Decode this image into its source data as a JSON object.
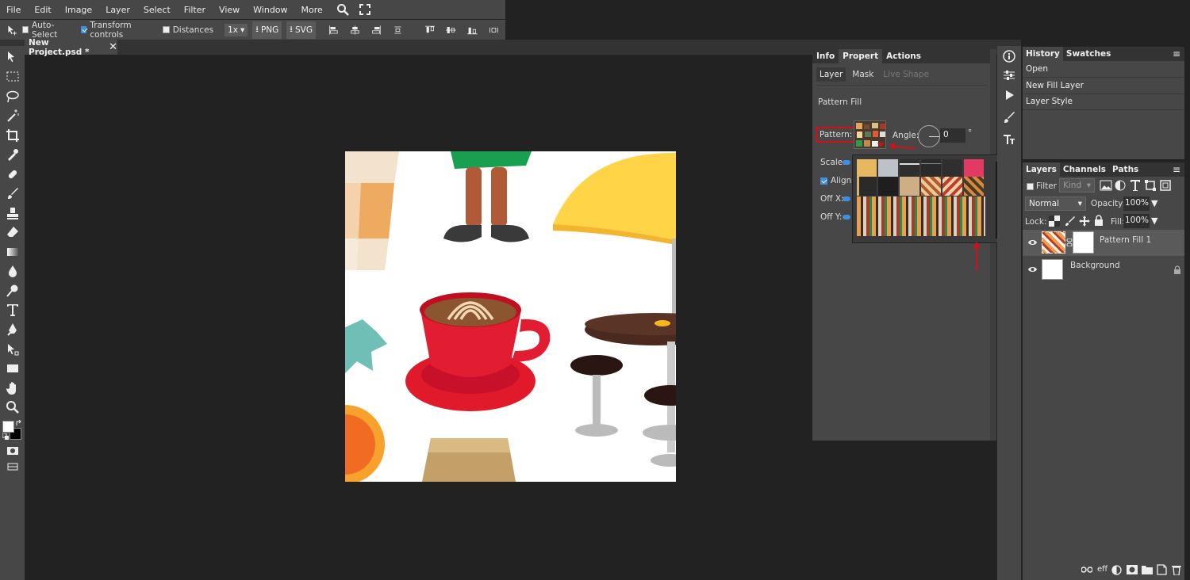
{
  "menu": {
    "items": [
      "File",
      "Edit",
      "Image",
      "Layer",
      "Select",
      "Filter",
      "View",
      "Window",
      "More"
    ]
  },
  "options": {
    "auto_select": "Auto-Select",
    "transform_controls": "Transform controls",
    "distances": "Distances",
    "zoom": "1x",
    "png": "PNG",
    "svg": "SVG"
  },
  "document": {
    "tab_title": "New Project.psd *",
    "close": "✕"
  },
  "properties": {
    "tabs": [
      "Info",
      "Propert",
      "Actions"
    ],
    "subtabs": [
      "Layer",
      "Mask",
      "Live Shape"
    ],
    "heading": "Pattern Fill",
    "pattern_label": "Pattern:",
    "angle_label": "Angle:",
    "angle_value": "0",
    "degree": "°",
    "scale_label": "Scale:",
    "align_label": "Align",
    "offx_label": "Off X:",
    "offy_label": "Off Y:"
  },
  "history": {
    "tabs": [
      "History",
      "Swatches"
    ],
    "items": [
      "Open",
      "New Fill Layer",
      "Layer Style"
    ]
  },
  "layers": {
    "tabs": [
      "Layers",
      "Channels",
      "Paths"
    ],
    "filter_label": "Filter",
    "kind_placeholder": "Kind",
    "blend_mode": "Normal",
    "opacity_label": "Opacity:",
    "opacity_value": "100%",
    "lock_label": "Lock:",
    "fill_label": "Fill:",
    "fill_value": "100%",
    "items": [
      {
        "name": "Pattern Fill 1"
      },
      {
        "name": "Background"
      }
    ],
    "footer_eff": "eff"
  },
  "colors": {
    "accent": "#3d8fe0",
    "highlight": "#d0101a"
  }
}
